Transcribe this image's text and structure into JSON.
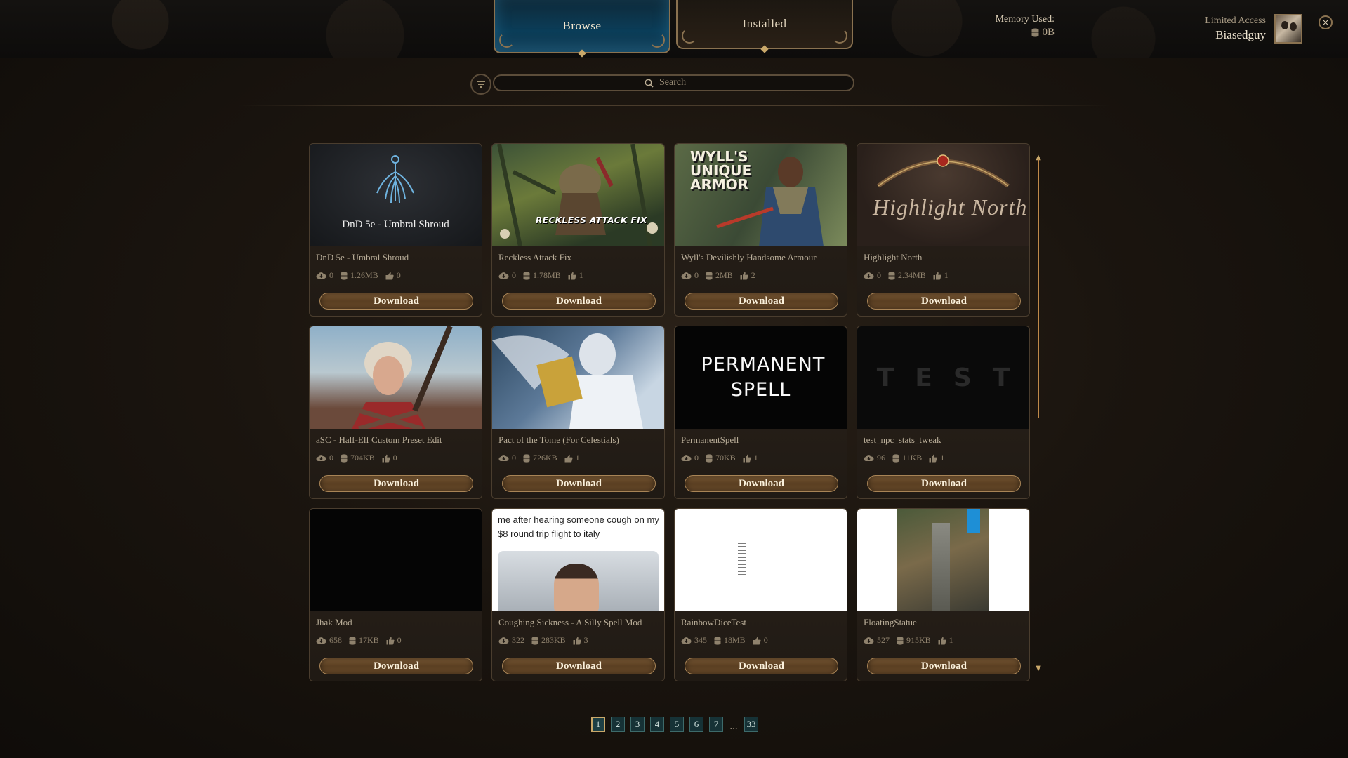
{
  "tabs": {
    "browse": "Browse",
    "installed": "Installed"
  },
  "memory": {
    "label": "Memory Used:",
    "value": "0B"
  },
  "user": {
    "access": "Limited Access",
    "name": "Biasedguy"
  },
  "close_glyph": "×",
  "search": {
    "placeholder": "Search"
  },
  "download_label": "Download",
  "mods": [
    {
      "title": "DnD 5e - Umbral Shroud",
      "thumb_text": "DnD 5e - Umbral Shroud",
      "downloads": "0",
      "size": "1.26MB",
      "likes": "0"
    },
    {
      "title": "Reckless Attack Fix",
      "thumb_text": "RECKLESS ATTACK FIX",
      "downloads": "0",
      "size": "1.78MB",
      "likes": "1"
    },
    {
      "title": "Wyll's Devilishly Handsome Armour",
      "thumb_text": "WYLL'S UNIQUE ARMOR",
      "downloads": "0",
      "size": "2MB",
      "likes": "2"
    },
    {
      "title": "Highlight North",
      "thumb_text": "Highlight North",
      "downloads": "0",
      "size": "2.34MB",
      "likes": "1"
    },
    {
      "title": "aSC - Half-Elf Custom Preset Edit",
      "thumb_text": "",
      "downloads": "0",
      "size": "704KB",
      "likes": "0"
    },
    {
      "title": "Pact of the Tome (For Celestials)",
      "thumb_text": "",
      "downloads": "0",
      "size": "726KB",
      "likes": "1"
    },
    {
      "title": "PermanentSpell",
      "thumb_text": "PERMANENT SPELL",
      "downloads": "0",
      "size": "70KB",
      "likes": "1"
    },
    {
      "title": "test_npc_stats_tweak",
      "thumb_text": "TEST",
      "downloads": "96",
      "size": "11KB",
      "likes": "1"
    },
    {
      "title": "Jhak Mod",
      "thumb_text": "",
      "downloads": "658",
      "size": "17KB",
      "likes": "0"
    },
    {
      "title": "Coughing Sickness - A Silly Spell Mod",
      "thumb_text": "me after hearing someone cough on my $8 round trip flight to italy",
      "downloads": "322",
      "size": "283KB",
      "likes": "3"
    },
    {
      "title": "RainbowDiceTest",
      "thumb_text": "",
      "downloads": "345",
      "size": "18MB",
      "likes": "0"
    },
    {
      "title": "FloatingStatue",
      "thumb_text": "",
      "downloads": "527",
      "size": "915KB",
      "likes": "1"
    }
  ],
  "pagination": {
    "pages": [
      "1",
      "2",
      "3",
      "4",
      "5",
      "6",
      "7"
    ],
    "ellipsis": "...",
    "last": "33",
    "current": "1"
  },
  "colors": {
    "accent": "#c9a86a",
    "browse_tab": "#0b3d58",
    "download_button": "#6a4a2a",
    "scroll": "#c08a4a"
  },
  "icons": {
    "downloads": "cloud-download-icon",
    "size": "database-icon",
    "likes": "thumbs-up-icon"
  }
}
